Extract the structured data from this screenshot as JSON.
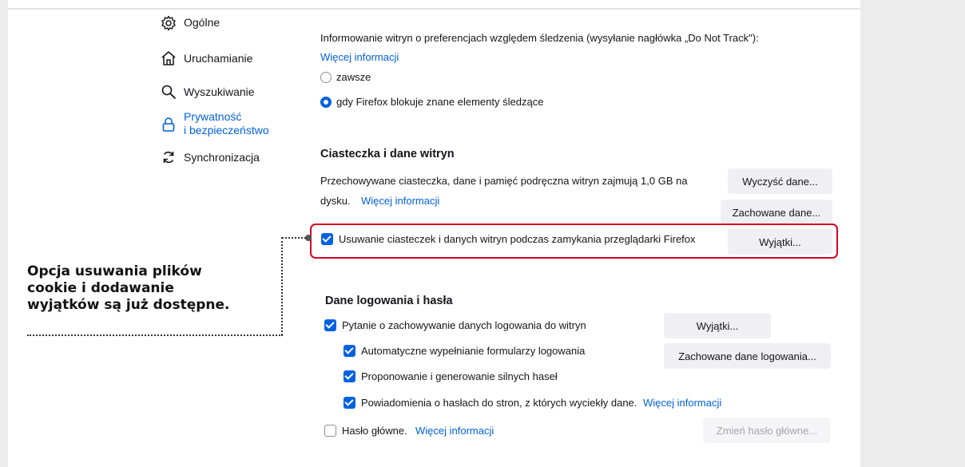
{
  "sidebar": {
    "items": [
      {
        "label": "Ogólne",
        "icon": "gear-icon"
      },
      {
        "label": "Uruchamianie",
        "icon": "home-icon"
      },
      {
        "label": "Wyszukiwanie",
        "icon": "search-icon"
      },
      {
        "label_line1": "Prywatność",
        "label_line2": "i bezpieczeństwo",
        "icon": "lock-icon",
        "active": true
      },
      {
        "label": "Synchronizacja",
        "icon": "sync-icon"
      }
    ]
  },
  "dnt": {
    "text": "Informowanie witryn o preferencjach względem śledzenia (wysyłanie nagłówka „Do Not Track\"):",
    "more_link": "Więcej informacji",
    "option_always": "zawsze",
    "option_blocking": "gdy Firefox blokuje znane elementy śledzące",
    "selected": "option_blocking"
  },
  "cookies": {
    "title": "Ciasteczka i dane witryn",
    "description_line1": "Przechowywane ciasteczka, dane i pamięć podręczna witryn zajmują 1,0 GB na",
    "description_line2": "dysku.",
    "more_link": "Więcej informacji",
    "clear_button": "Wyczyść dane...",
    "manage_button": "Zachowane dane...",
    "delete_on_close_label": "Usuwanie ciasteczek i danych witryn podczas zamykania przeglądarki Firefox",
    "delete_on_close_checked": true,
    "exceptions_button": "Wyjątki..."
  },
  "callout": {
    "line1": "Opcja usuwania plików",
    "line2": "cookie i dodawanie",
    "line3": "wyjątków są już dostępne."
  },
  "logins": {
    "title": "Dane logowania i hasła",
    "ask_to_save_label": "Pytanie o zachowywanie danych logowania do witryn",
    "ask_to_save_checked": true,
    "autofill_label": "Automatyczne wypełnianie formularzy logowania",
    "autofill_checked": true,
    "suggest_label": "Proponowanie i generowanie silnych haseł",
    "suggest_checked": true,
    "alerts_label": "Powiadomienia o hasłach do stron, z których wyciekły dane.",
    "alerts_checked": true,
    "alerts_link": "Więcej informacji",
    "primary_password_label": "Hasło główne.",
    "primary_password_checked": false,
    "primary_password_link": "Więcej informacji",
    "exceptions_button": "Wyjątki...",
    "saved_logins_button": "Zachowane dane logowania...",
    "change_primary_button": "Zmień hasło główne..."
  },
  "colors": {
    "accent": "#0061e0",
    "highlight": "#d70022"
  }
}
